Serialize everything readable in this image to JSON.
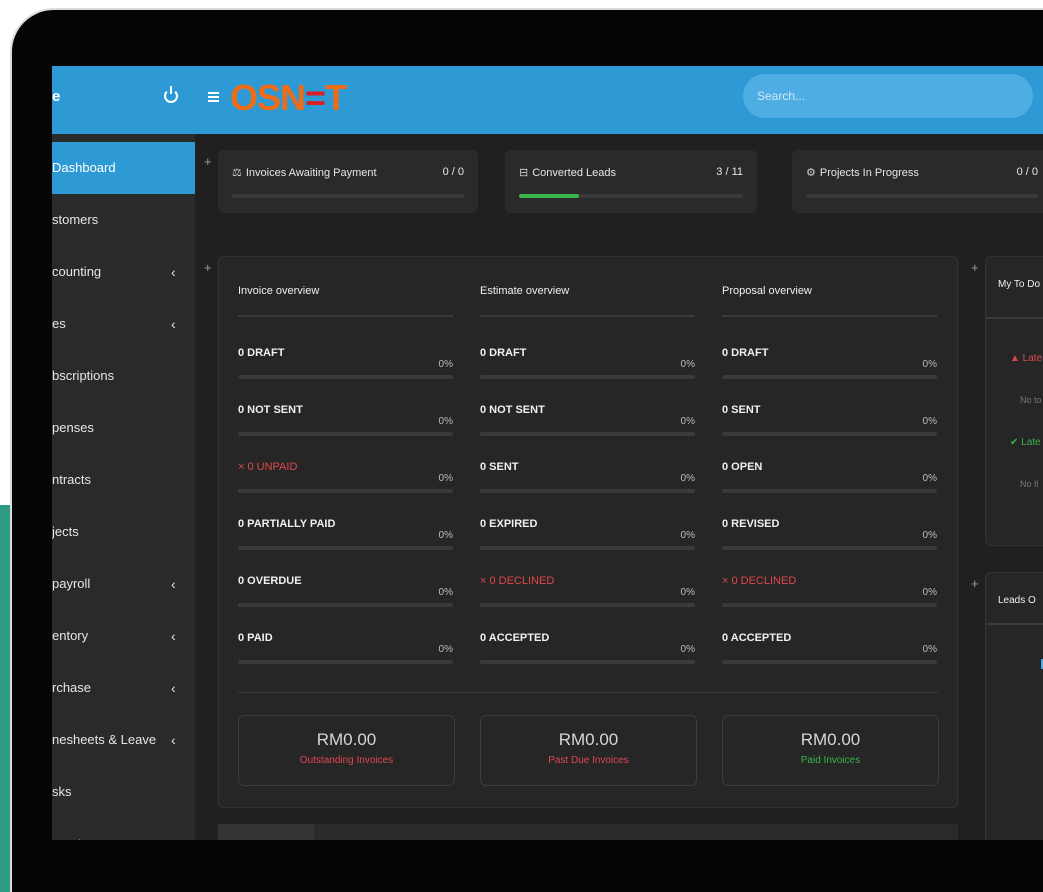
{
  "colors": {
    "brand_blue": "#2d9ad6",
    "logo_orange": "#ee6c16",
    "logo_red": "#d71f26",
    "danger": "#e0484d",
    "success": "#39b54a",
    "teal_accent": "#2e9c84"
  },
  "header": {
    "user_initial": "e",
    "logo_text_start": "OSN",
    "logo_text_mid": "=",
    "logo_text_end": "T",
    "search_placeholder": "Search..."
  },
  "sidebar": {
    "items": [
      {
        "label": "Dashboard",
        "active": true,
        "has_submenu": false
      },
      {
        "label": "stomers",
        "has_submenu": false
      },
      {
        "label": "counting",
        "has_submenu": true
      },
      {
        "label": "es",
        "has_submenu": true
      },
      {
        "label": "bscriptions",
        "has_submenu": false
      },
      {
        "label": "penses",
        "has_submenu": false
      },
      {
        "label": "ntracts",
        "has_submenu": false
      },
      {
        "label": "jects",
        "has_submenu": false
      },
      {
        "label": "payroll",
        "has_submenu": true
      },
      {
        "label": "entory",
        "has_submenu": true
      },
      {
        "label": "rchase",
        "has_submenu": true
      },
      {
        "label": "nesheets & Leave",
        "has_submenu": true
      },
      {
        "label": "sks",
        "has_submenu": false
      },
      {
        "label": "pport",
        "has_submenu": false
      }
    ],
    "chevron": "‹"
  },
  "stats": [
    {
      "icon": "invoice-icon",
      "label": "Invoices Awaiting Payment",
      "value": "0 / 0",
      "progress": 0
    },
    {
      "icon": "converted-leads-icon",
      "label": "Converted Leads",
      "value": "3 / 11",
      "progress": 0.27
    },
    {
      "icon": "projects-icon",
      "label": "Projects In Progress",
      "value": "0 / 0",
      "progress": 0
    }
  ],
  "overview": {
    "columns": [
      {
        "title": "Invoice overview",
        "rows": [
          {
            "label": "0 DRAFT",
            "pct": "0%",
            "status": "normal"
          },
          {
            "label": "0 NOT SENT",
            "pct": "0%",
            "status": "normal"
          },
          {
            "label": "× 0 UNPAID",
            "pct": "0%",
            "status": "danger"
          },
          {
            "label": "0 PARTIALLY PAID",
            "pct": "0%",
            "status": "normal"
          },
          {
            "label": "0 OVERDUE",
            "pct": "0%",
            "status": "normal"
          },
          {
            "label": "0 PAID",
            "pct": "0%",
            "status": "normal"
          }
        ]
      },
      {
        "title": "Estimate overview",
        "rows": [
          {
            "label": "0 DRAFT",
            "pct": "0%",
            "status": "normal"
          },
          {
            "label": "0 NOT SENT",
            "pct": "0%",
            "status": "normal"
          },
          {
            "label": "0 SENT",
            "pct": "0%",
            "status": "normal"
          },
          {
            "label": "0 EXPIRED",
            "pct": "0%",
            "status": "normal"
          },
          {
            "label": "× 0 DECLINED",
            "pct": "0%",
            "status": "danger"
          },
          {
            "label": "0 ACCEPTED",
            "pct": "0%",
            "status": "normal"
          }
        ]
      },
      {
        "title": "Proposal overview",
        "rows": [
          {
            "label": "0 DRAFT",
            "pct": "0%",
            "status": "normal"
          },
          {
            "label": "0 SENT",
            "pct": "0%",
            "status": "normal"
          },
          {
            "label": "0 OPEN",
            "pct": "0%",
            "status": "normal"
          },
          {
            "label": "0 REVISED",
            "pct": "0%",
            "status": "normal"
          },
          {
            "label": "× 0 DECLINED",
            "pct": "0%",
            "status": "danger"
          },
          {
            "label": "0 ACCEPTED",
            "pct": "0%",
            "status": "normal"
          }
        ]
      }
    ],
    "totals": [
      {
        "amount": "RM0.00",
        "caption": "Outstanding Invoices",
        "color": "#e0484d"
      },
      {
        "amount": "RM0.00",
        "caption": "Past Due Invoices",
        "color": "#e0484d"
      },
      {
        "amount": "RM0.00",
        "caption": "Paid Invoices",
        "color": "#39b54a"
      }
    ]
  },
  "todo": {
    "title": "My To Do",
    "late_label": "▲ Late",
    "late_empty": "No to",
    "latest_label": "✔ Late",
    "latest_empty": "No fi"
  },
  "leads": {
    "title": "Leads O"
  },
  "plus_symbol": "+"
}
